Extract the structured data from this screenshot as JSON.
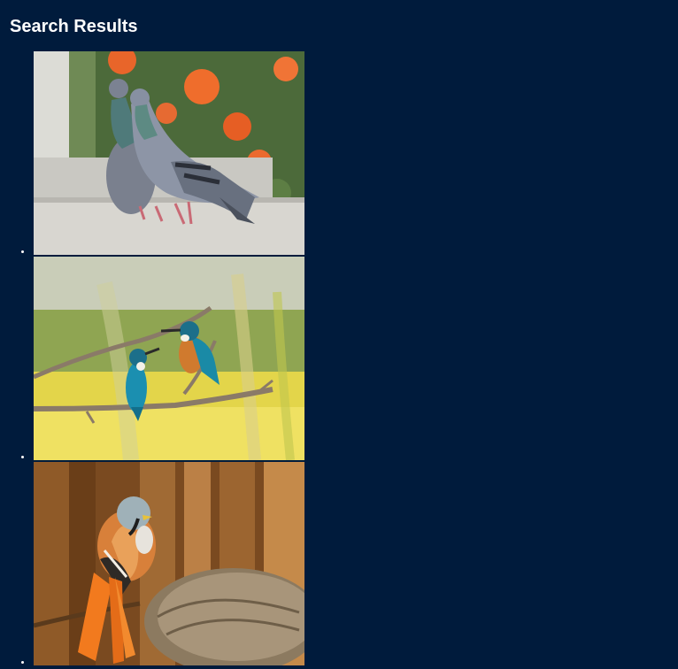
{
  "heading": "Search Results",
  "results": [
    {
      "icon": "pigeons-image"
    },
    {
      "icon": "kingfishers-image"
    },
    {
      "icon": "bearded-reedling-image"
    }
  ],
  "colors": {
    "background": "#001b3c",
    "text": "#ffffff"
  }
}
